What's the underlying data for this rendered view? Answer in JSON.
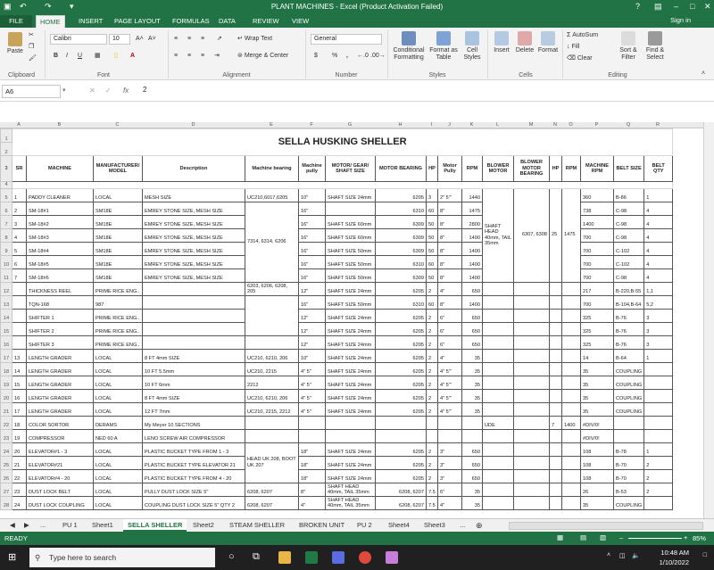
{
  "window": {
    "title": "PLANT MACHINES -  Excel (Product Activation Failed)",
    "help": "?",
    "controls": [
      "–",
      "□",
      "✕"
    ]
  },
  "tabs": [
    "FILE",
    "HOME",
    "INSERT",
    "PAGE LAYOUT",
    "FORMULAS",
    "DATA",
    "REVIEW",
    "VIEW"
  ],
  "signin": "Sign in",
  "ribbon": {
    "paste": "Paste",
    "clipboard": "Clipboard",
    "font_name": "Calibri",
    "font_size": "10",
    "font": "Font",
    "bold": "B",
    "italic": "I",
    "underline": "U",
    "wrap": "Wrap Text",
    "merge": "Merge & Center",
    "alignment": "Alignment",
    "numfmt": "General",
    "number": "Number",
    "currency": "$",
    "percent": "%",
    "comma": ",",
    "cond": "Conditional Formatting",
    "fmt_table": "Format as Table",
    "cell_styles": "Cell Styles",
    "styles": "Styles",
    "insert": "Insert",
    "delete": "Delete",
    "format": "Format",
    "cells": "Cells",
    "autosum": "AutoSum",
    "fill": "Fill",
    "clear": "Clear",
    "sort": "Sort & Filter",
    "find": "Find & Select",
    "editing": "Editing"
  },
  "formula": {
    "name_box": "A6",
    "fx": "fx",
    "value": "2"
  },
  "columns": [
    "A",
    "B",
    "C",
    "D",
    "E",
    "F",
    "G",
    "H",
    "I",
    "J",
    "K",
    "L",
    "M",
    "N",
    "O",
    "P",
    "Q",
    "R"
  ],
  "sheet": {
    "title": "SELLA HUSKING SHELLER",
    "headers": [
      "SR",
      "MACHINE",
      "MANUFACTURER/ MODEL",
      "Description",
      "Machine bearing",
      "Machine pully",
      "MOTOR/ GEAR/ SHAFT SIZE",
      "MOTOR BEARING",
      "HP",
      "Motor Pully",
      "RPM",
      "BLOWER MOTOR",
      "BLOWER MOTOR BEARING",
      "HP",
      "RPM",
      "MACHINE RPM",
      "BELT SIZE",
      "BELT QTY"
    ],
    "rows": [
      {
        "n": "5",
        "c": [
          "1",
          "PADDY CLEANER",
          "LOCAL",
          "MESH SIZE",
          "UC210,6017,6205",
          "10\"",
          "SHAFT SIZE 24mm",
          "6205",
          "3",
          "2\" 5\"'",
          "1440",
          "",
          "",
          "",
          "",
          "360",
          "B-86",
          "1"
        ]
      },
      {
        "n": "6",
        "c": [
          "2",
          "SM-18#1",
          "SM18E",
          "EMREY STONE SIZE, MESH SIZE",
          "",
          "16\"",
          "",
          "6310",
          "60",
          "8\"",
          "1475",
          "",
          "",
          "",
          "",
          "738",
          "C-98",
          "4"
        ]
      },
      {
        "n": "7",
        "c": [
          "3",
          "SM-18#2",
          "SM18E",
          "EMREY STONE SIZE, MESH SIZE",
          "",
          "16\"",
          "SHAFT SIZE 60mm",
          "6309",
          "50",
          "8\"",
          "2800",
          "",
          "",
          "",
          "",
          "1400",
          "C-98",
          "4"
        ]
      },
      {
        "n": "8",
        "c": [
          "4",
          "SM-18#3",
          "SM18E",
          "EMREY STONE SIZE, MESH SIZE",
          "7314, 6314, 6206",
          "16\"",
          "SHAFT SIZE 60mm",
          "6309",
          "50",
          "8\"",
          "1400",
          "SHAFT HEAD 40mm, TAIL 35mm",
          "6307, 6308",
          "25",
          "1475",
          "700",
          "C-98",
          "4"
        ]
      },
      {
        "n": "9",
        "c": [
          "5",
          "SM-18#4",
          "SM18E",
          "EMREY STONE SIZE, MESH SIZE",
          "",
          "16\"",
          "SHAFT SIZE 50mm",
          "6309",
          "50",
          "8\"",
          "1400",
          "",
          "",
          "",
          "",
          "700",
          "C-102",
          "4"
        ]
      },
      {
        "n": "10",
        "c": [
          "6",
          "SM-18#5",
          "SM18E",
          "EMREY STONE SIZE, MESH SIZE",
          "",
          "16\"",
          "SHAFT SIZE 50mm",
          "6310",
          "60",
          "8\"",
          "1400",
          "",
          "",
          "",
          "",
          "700",
          "C-102",
          "4"
        ]
      },
      {
        "n": "11",
        "c": [
          "7",
          "SM-18#6",
          "SM18E",
          "EMREY STONE SIZE, MESH SIZE",
          "",
          "16\"",
          "SHAFT SIZE 50mm",
          "6309",
          "50",
          "8\"",
          "1400",
          "",
          "",
          "",
          "",
          "700",
          "C-98",
          "4"
        ]
      },
      {
        "n": "12",
        "c": [
          "",
          "THICKNESS REEL",
          "PRIME RICE ENG..",
          "",
          "6203, 6206, 6208, 205",
          "12\"",
          "SHAFT SIZE 24mm",
          "6205",
          "2",
          "4\"",
          "650",
          "",
          "",
          "",
          "",
          "217",
          "B-220,B-55",
          "1,1"
        ]
      },
      {
        "n": "13",
        "c": [
          "",
          "TQN-168",
          "987",
          "",
          "6017, 6215",
          "16\"",
          "SHAFT SIZE 50mm",
          "6310",
          "60",
          "8\"",
          "1400",
          "",
          "",
          "",
          "",
          "700",
          "B-104,B-64",
          "5,2"
        ]
      },
      {
        "n": "14",
        "c": [
          "",
          "SHIFTER 1",
          "PRIME RICE ENG..",
          "",
          "",
          "12\"",
          "SHAFT SIZE 24mm",
          "6205",
          "2",
          "6\"",
          "650",
          "",
          "",
          "",
          "",
          "325",
          "B-76",
          "3"
        ]
      },
      {
        "n": "15",
        "c": [
          "",
          "SHIFTER 2",
          "PRIME RICE ENG..",
          "",
          "UC210, 6205, 2309",
          "12\"",
          "SHAFT SIZE 24mm",
          "6205",
          "2",
          "6\"",
          "650",
          "",
          "",
          "",
          "",
          "325",
          "B-76",
          "3"
        ]
      },
      {
        "n": "16",
        "c": [
          "",
          "SHIFTER 3",
          "PRIME RICE ENG..",
          "",
          "",
          "12\"",
          "SHAFT SIZE 24mm",
          "6205",
          "2",
          "6\"",
          "650",
          "",
          "",
          "",
          "",
          "325",
          "B-76",
          "3"
        ]
      },
      {
        "n": "17",
        "c": [
          "13",
          "LENGTH GRADER",
          "LOCAL",
          "8 FT 4mm SIZE",
          "UC210, 6210, 206",
          "10\"",
          "SHAFT SIZE 24mm",
          "6205",
          "2",
          "4\"",
          "35",
          "",
          "",
          "",
          "",
          "14",
          "B-64",
          "1"
        ]
      },
      {
        "n": "18",
        "c": [
          "14",
          "LENGTH GRADER",
          "LOCAL",
          "10 FT 5.5mm",
          "UC210, 2215",
          "4\" 5\"",
          "SHAFT SIZE 24mm",
          "6205",
          "2",
          "4\" 5\"'",
          "35",
          "",
          "",
          "",
          "",
          "35",
          "COUPLING",
          ""
        ]
      },
      {
        "n": "19",
        "c": [
          "15",
          "LENGTH GRADER",
          "LOCAL",
          "10 FT 6mm",
          "2212",
          "4\" 5\"",
          "SHAFT SIZE 24mm",
          "6205",
          "2",
          "4\" 5\"'",
          "35",
          "",
          "",
          "",
          "",
          "35",
          "COUPLING",
          ""
        ]
      },
      {
        "n": "20",
        "c": [
          "16",
          "LENGTH GRADER",
          "LOCAL",
          "8 FT 4mm SIZE",
          "UC210, 6210, 206",
          "4\" 5\"",
          "SHAFT SIZE 24mm",
          "6205",
          "2",
          "4\" 5\"'",
          "35",
          "",
          "",
          "",
          "",
          "35",
          "COUPLING",
          ""
        ]
      },
      {
        "n": "21",
        "c": [
          "17",
          "LENGTH GRADER",
          "LOCAL",
          "12 FT 7mm",
          "UC210, 2215, 2212",
          "4\" 5\"",
          "SHAFT SIZE 24mm",
          "6205",
          "2",
          "4\" 5\"'",
          "35",
          "",
          "",
          "",
          "",
          "35",
          "COUPLING",
          ""
        ]
      },
      {
        "n": "22",
        "c": [
          "18",
          "COLOR SORTOR",
          "DERAMS",
          "My Meyer 10 SECTIONS",
          "",
          "",
          "",
          "",
          "",
          "",
          "",
          "UDE",
          "",
          "7",
          "1400",
          "#DIV/0!",
          "",
          ""
        ]
      },
      {
        "n": "23",
        "c": [
          "19",
          "COMPRESSOR",
          "NED 60 A",
          "LENO SCREW AIR COMPRESSOR",
          "",
          "",
          "",
          "",
          "",
          "",
          "",
          "",
          "",
          "",
          "",
          "#DIV/0!",
          "",
          ""
        ]
      },
      {
        "n": "24",
        "c": [
          "20",
          "ELEVATOR#1 - 3",
          "LOCAL",
          "PLASTIC BUCKET TYPE FROM 1 - 3",
          "",
          "18\"",
          "SHAFT SIZE 24mm",
          "6205",
          "2",
          "3\"",
          "650",
          "",
          "",
          "",
          "",
          "108",
          "B-78",
          "1"
        ]
      },
      {
        "n": "25",
        "c": [
          "21",
          "ELEVATOR#21",
          "LOCAL",
          "PLASTIC BUCKET TYPE  ELEVATOR 21",
          "HEAD UK 208, BOOT UK 207",
          "18\"",
          "SHAFT SIZE 24mm",
          "6205",
          "2",
          "3\"",
          "650",
          "",
          "",
          "",
          "",
          "108",
          "B-70",
          "2"
        ]
      },
      {
        "n": "26",
        "c": [
          "22",
          "ELEVATOR#4 - 20",
          "LOCAL",
          "PLASTIC BUCKET TYPE FROM 4 - 20",
          "",
          "18\"",
          "SHAFT SIZE 24mm",
          "6205",
          "2",
          "3\"",
          "650",
          "",
          "",
          "",
          "",
          "108",
          "B-70",
          "2"
        ]
      },
      {
        "n": "27",
        "c": [
          "23",
          "DUST LOCK BELT",
          "LOCAL",
          "PULLY DUST LOCK SIZE 5\"",
          "6208, 6207",
          "8\"",
          "SHAFT HEAD 40mm, TAIL 35mm",
          "6208, 6207",
          "7.5",
          "6\"",
          "35",
          "",
          "",
          "",
          "",
          "26",
          "B-53",
          "2"
        ]
      },
      {
        "n": "28",
        "c": [
          "24",
          "DUST LOCK COUPLING",
          "LOCAL",
          "COUPLING DUST LOCK SIZE 5\" QTY 2",
          "6208, 6207",
          "4\"",
          "SHAFT HEAD 40mm, TAIL 35mm",
          "6208, 6207",
          "7.5",
          "4\"",
          "35",
          "",
          "",
          "",
          "",
          "35",
          "COUPLING",
          ""
        ]
      }
    ]
  },
  "sheets": [
    "PU 1",
    "Sheet1",
    "SELLA SHELLER",
    "Sheet2",
    "STEAM SHELLER",
    "BROKEN UNIT",
    "PU 2",
    "Sheet4",
    "Sheet3"
  ],
  "status": {
    "ready": "READY",
    "zoom": "85%"
  },
  "taskbar": {
    "search": "Type here to search",
    "time": "10:48 AM",
    "date": "1/10/2022"
  }
}
